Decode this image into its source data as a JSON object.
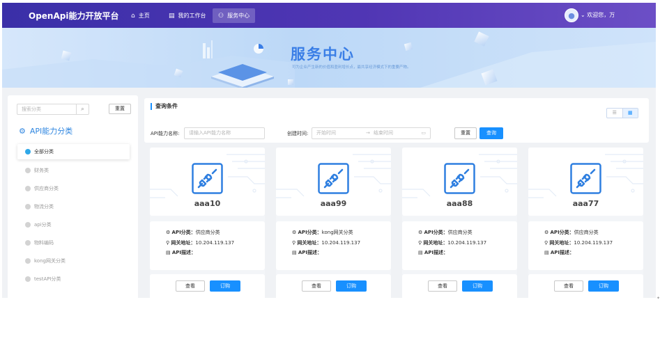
{
  "header": {
    "logo": "OpenApi能力开放平台",
    "nav": [
      {
        "label": "主页",
        "icon": "home-icon"
      },
      {
        "label": "我的工作台",
        "icon": "workbench-icon"
      },
      {
        "label": "服务中心",
        "icon": "service-icon",
        "active": true
      }
    ],
    "welcome": "欢迎您，万"
  },
  "banner": {
    "title": "服务中心",
    "subtitle": "可为企业产生新的价值和盈利增长点，最共享经济模式下的重要产物。"
  },
  "sidebar": {
    "search_placeholder": "搜索分类",
    "reset_label": "重置",
    "title": "API能力分类",
    "categories": [
      "全部分类",
      "财务类",
      "供应商分类",
      "物流分类",
      "api分类",
      "物料编码",
      "kong网关分类",
      "testAPI分类"
    ],
    "active_index": 0
  },
  "filter": {
    "title": "查询条件",
    "api_name_label": "API能力名称:",
    "api_name_placeholder": "请输入API能力名称",
    "created_label": "创建时间:",
    "start_placeholder": "开始时间",
    "arrow": "→",
    "end_placeholder": "结束时间",
    "reset_label": "重置",
    "search_label": "查询"
  },
  "card_labels": {
    "category": "API分类：",
    "gateway": "网关地址：",
    "description": "API描述：",
    "view": "查看",
    "subscribe": "订购"
  },
  "cards": [
    {
      "name": "aaa10",
      "category": "供应商分类",
      "gateway": "10.204.119.137",
      "description": ""
    },
    {
      "name": "aaa99",
      "category": "kong网关分类",
      "gateway": "10.204.119.137",
      "description": ""
    },
    {
      "name": "aaa88",
      "category": "供应商分类",
      "gateway": "10.204.119.137",
      "description": ""
    },
    {
      "name": "aaa77",
      "category": "供应商分类",
      "gateway": "10.204.119.137",
      "description": ""
    }
  ],
  "colors": {
    "header": "#4a34b0",
    "primary": "#1890ff",
    "banner_title": "#3a7ee6"
  }
}
